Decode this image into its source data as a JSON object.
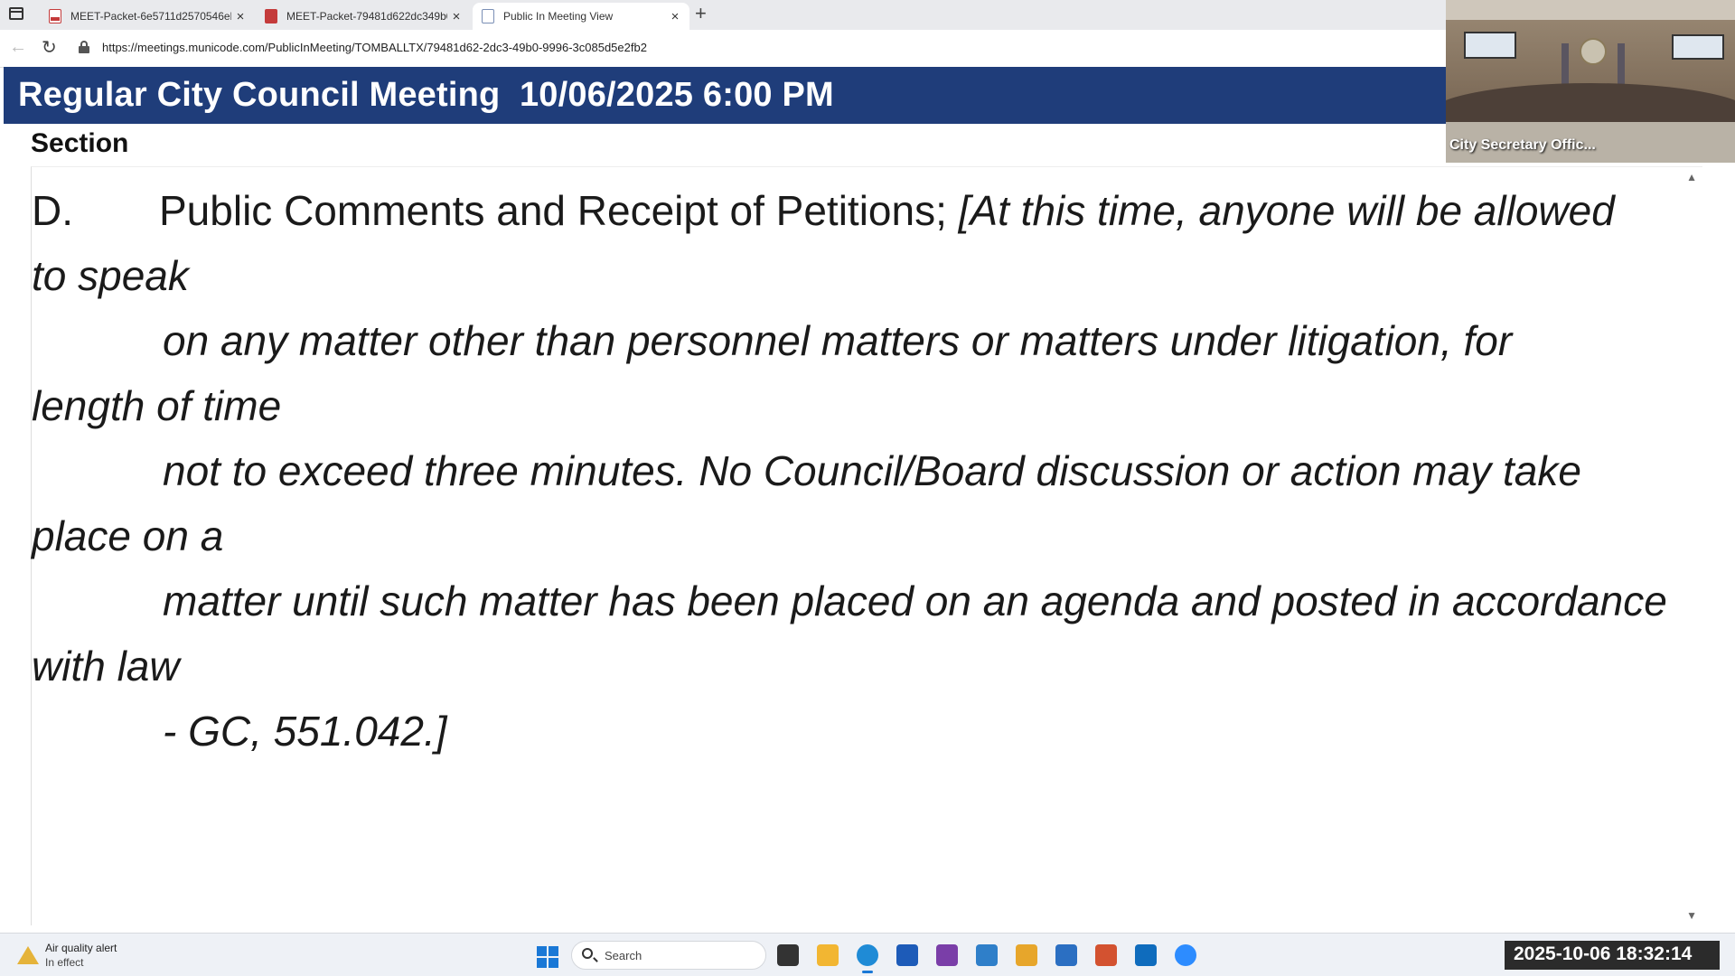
{
  "browser": {
    "tabs": [
      {
        "title": "MEET-Packet-6e5711d2570546eb",
        "icon": "pdf-icon",
        "active": false
      },
      {
        "title": "MEET-Packet-79481d622dc349b0",
        "icon": "pdf-icon",
        "active": false
      },
      {
        "title": "Public In Meeting View",
        "icon": "page-icon",
        "active": true
      }
    ],
    "close_glyph": "×",
    "new_tab_glyph": "+",
    "back_glyph": "←",
    "reload_glyph": "↻",
    "url": "https://meetings.municode.com/PublicInMeeting/TOMBALLTX/79481d62-2dc3-49b0-9996-3c085d5e2fb2"
  },
  "meeting": {
    "title": "Regular City Council Meeting  10/06/2025 6:00 PM",
    "section_label": "Section",
    "agenda": {
      "code": "D.",
      "heading": "Public Comments and Receipt of Petitions;",
      "note_part1": "[At this time, anyone will be allowed",
      "note_part2": "to speak",
      "note_part3": "on any matter other than personnel matters or matters under litigation, for",
      "note_part4": "length of time",
      "note_part5": "not to exceed three minutes. No Council/Board discussion or action may take",
      "note_part6": "place on a",
      "note_part7": "matter until such matter has been placed on an agenda and posted in accordance",
      "note_part8": "with law",
      "note_part9": "- GC, 551.042.]"
    },
    "scroll_up_glyph": "▲",
    "scroll_down_glyph": "▼"
  },
  "video": {
    "participant_name": "City Secretary Offic..."
  },
  "taskbar": {
    "alert_title": "Air quality alert",
    "alert_subtitle": "In effect",
    "search_placeholder": "Search",
    "clock": "2025-10-06  18:32:14",
    "apps": [
      {
        "name": "task-view-icon",
        "color": "#333333"
      },
      {
        "name": "file-explorer-icon",
        "color": "#f2b632"
      },
      {
        "name": "edge-icon",
        "color": "#1f8bd6"
      },
      {
        "name": "store-icon",
        "color": "#1d5bb8"
      },
      {
        "name": "power-automate-icon",
        "color": "#7a3ea8"
      },
      {
        "name": "remote-desktop-icon",
        "color": "#2f7fc9"
      },
      {
        "name": "notes-icon",
        "color": "#e7a62b"
      },
      {
        "name": "remote-connection-icon",
        "color": "#2b6fc2"
      },
      {
        "name": "powerpoint-icon",
        "color": "#d35230"
      },
      {
        "name": "outlook-icon",
        "color": "#0f6cbd"
      },
      {
        "name": "zoom-icon",
        "color": "#2d8cff"
      }
    ]
  },
  "colors": {
    "header_bg": "#1f3d7a",
    "accent": "#1a78d6"
  }
}
